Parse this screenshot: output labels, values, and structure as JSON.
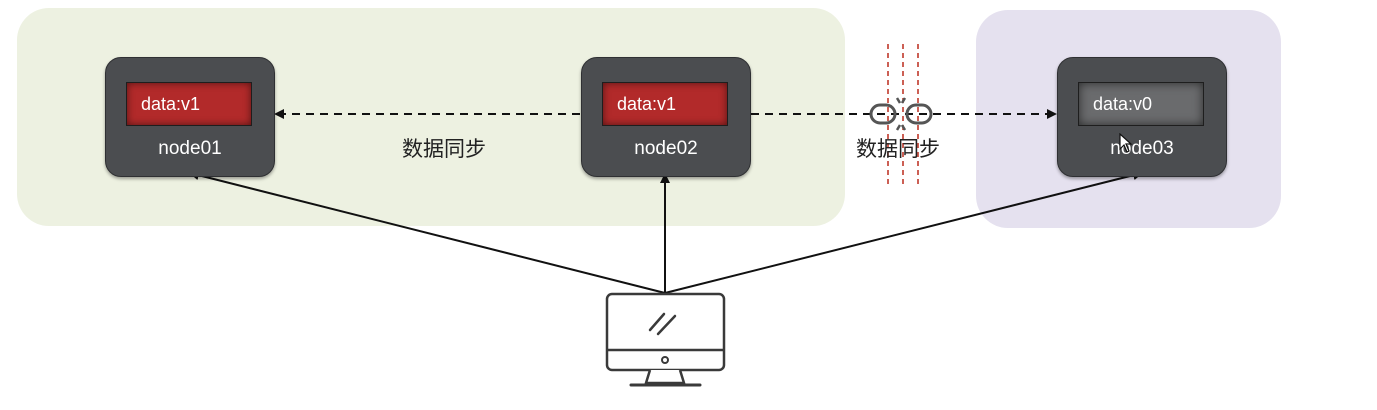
{
  "nodes": [
    {
      "name": "node01",
      "data": "data:v1",
      "state": "v1"
    },
    {
      "name": "node02",
      "data": "data:v1",
      "state": "v1"
    },
    {
      "name": "node03",
      "data": "data:v0",
      "state": "v0"
    }
  ],
  "sync_labels": [
    "数据同步",
    "数据同步"
  ],
  "icons": {
    "client": "desktop-monitor-icon",
    "break": "broken-link-icon",
    "cursor": "mouse-cursor-icon"
  },
  "colors": {
    "zone_left": "#edf1e1",
    "zone_right": "#e5e1ef",
    "node_bg": "#4b4d50",
    "data_current": "#b22a2a",
    "data_stale": "#6a6b6d",
    "partition_line": "#c0392b"
  }
}
